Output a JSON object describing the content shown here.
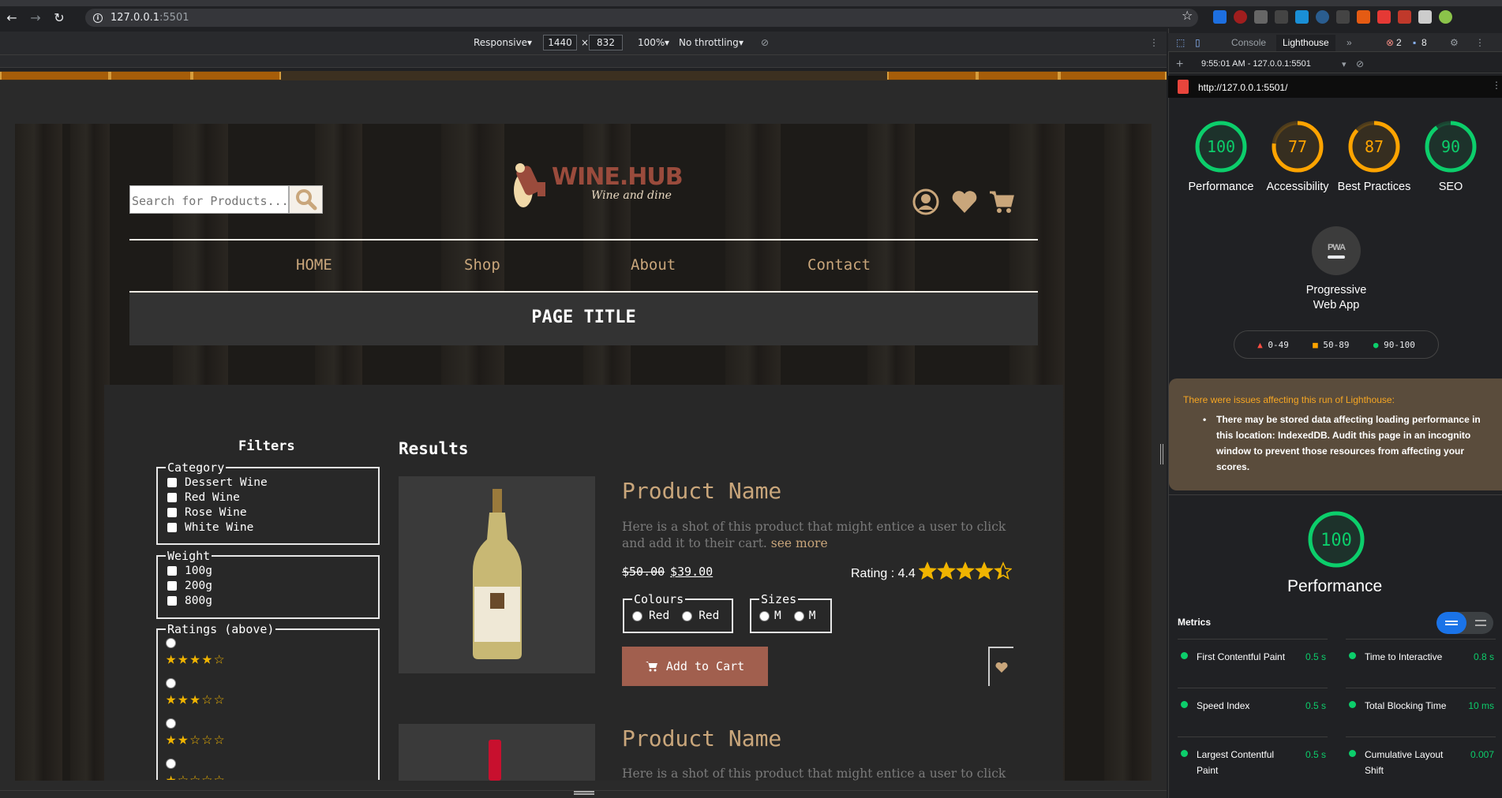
{
  "browser": {
    "url_host": "127.0.0.1",
    "url_port": ":5501"
  },
  "device_toolbar": {
    "mode": "Responsive",
    "width": "1440",
    "height": "832",
    "times": "×",
    "zoom": "100%",
    "throttle": "No throttling"
  },
  "site": {
    "search_placeholder": "Search for Products...",
    "logo_name": "WINE.HUB",
    "logo_tagline": "Wine and dine",
    "nav": [
      "HOME",
      "Shop",
      "About",
      "Contact"
    ],
    "page_title": "PAGE TITLE",
    "filters": {
      "title": "Filters",
      "category_legend": "Category",
      "categories": [
        "Dessert Wine",
        "Red Wine",
        "Rose Wine",
        "White Wine"
      ],
      "weight_legend": "Weight",
      "weights": [
        "100g",
        "200g",
        "800g"
      ],
      "ratings_legend": "Ratings (above)",
      "rating_rows": [
        "★★★★☆",
        "★★★☆☆",
        "★★☆☆☆",
        "★☆☆☆☆"
      ]
    },
    "results_title": "Results",
    "product1": {
      "name": "Product Name",
      "desc": "Here is a shot of this product that might entice a user to click and add it to their cart.",
      "see_more": "see more",
      "old_price": "$50.00",
      "new_price": "$39.00",
      "rating_label": "Rating : 4.4",
      "rating": 4.4,
      "colours_legend": "Colours",
      "colours": [
        "Red",
        "Red"
      ],
      "sizes_legend": "Sizes",
      "sizes": [
        "M",
        "M"
      ],
      "add_to_cart": "Add to Cart"
    },
    "product2": {
      "name": "Product Name",
      "desc": "Here is a shot of this product that might entice a user to click and add"
    }
  },
  "devtools": {
    "tabs": [
      "Console",
      "Lighthouse"
    ],
    "errors": "2",
    "messages": "8",
    "report_time": "9:55:01 AM - 127.0.0.1:5501",
    "report_url": "http://127.0.0.1:5501/",
    "scores": [
      {
        "value": "100",
        "label": "Performance",
        "color": "#0cce6b",
        "fraction": 1.0
      },
      {
        "value": "77",
        "label": "Accessibility",
        "color": "#ffa400",
        "fraction": 0.77
      },
      {
        "value": "87",
        "label": "Best Practices",
        "color": "#ffa400",
        "fraction": 0.87
      },
      {
        "value": "90",
        "label": "SEO",
        "color": "#0cce6b",
        "fraction": 0.9
      }
    ],
    "pwa_label": "Progressive Web App",
    "pwa_badge": "PWA",
    "legend": [
      "0-49",
      "50-89",
      "90-100"
    ],
    "warning_title": "There were issues affecting this run of Lighthouse:",
    "warning_text": "There may be stored data affecting loading performance in this location: IndexedDB. Audit this page in an incognito window to prevent those resources from affecting your scores.",
    "perf_score": "100",
    "perf_label": "Performance",
    "metrics_title": "Metrics",
    "metrics": [
      {
        "name": "First Contentful Paint",
        "value": "0.5 s"
      },
      {
        "name": "Time to Interactive",
        "value": "0.8 s"
      },
      {
        "name": "Speed Index",
        "value": "0.5 s"
      },
      {
        "name": "Total Blocking Time",
        "value": "10 ms"
      },
      {
        "name": "Largest Contentful Paint",
        "value": "0.5 s"
      },
      {
        "name": "Cumulative Layout Shift",
        "value": "0.007"
      }
    ]
  }
}
